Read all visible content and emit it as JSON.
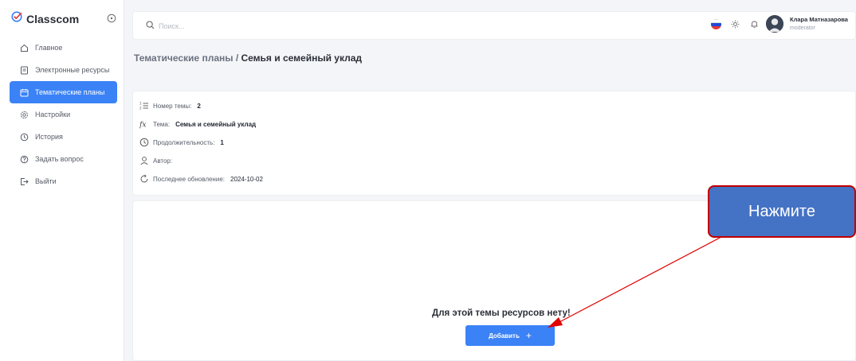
{
  "app": {
    "brand": "Classcom",
    "accent_color": "#3b82f6"
  },
  "sidebar": {
    "items": [
      {
        "label": "Главное",
        "icon": "home-icon",
        "active": false
      },
      {
        "label": "Электронные ресурсы",
        "icon": "book-icon",
        "active": false
      },
      {
        "label": "Тематические планы",
        "icon": "calendar-icon",
        "active": true
      },
      {
        "label": "Настройки",
        "icon": "gear-icon",
        "active": false
      },
      {
        "label": "История",
        "icon": "history-icon",
        "active": false
      },
      {
        "label": "Задать вопрос",
        "icon": "help-icon",
        "active": false
      },
      {
        "label": "Выйти",
        "icon": "logout-icon",
        "active": false
      }
    ]
  },
  "header": {
    "search_placeholder": "Поиск...",
    "user": {
      "name": "Клара Матназарова",
      "role": "moderator"
    }
  },
  "breadcrumb": {
    "parent": "Тематические планы",
    "separator": " / ",
    "current": "Семья и семейный уклад"
  },
  "topic": {
    "number_label": "Номер темы:",
    "number_value": "2",
    "theme_label": "Тема:",
    "theme_value": "Семья и семейный уклад",
    "duration_label": "Продолжительность:",
    "duration_value": "1",
    "author_label": "Автор:",
    "author_value": "",
    "updated_label": "Последнее обновление:",
    "updated_value": "2024-10-02"
  },
  "resources": {
    "empty_message": "Для этой темы ресурсов нету!",
    "add_label": "Добавить",
    "add_symbol": "+"
  },
  "annotation": {
    "callout_text": "Нажмите",
    "callout_fill": "#4472c4",
    "callout_border": "#c00000",
    "arrow_color": "#e00000"
  }
}
